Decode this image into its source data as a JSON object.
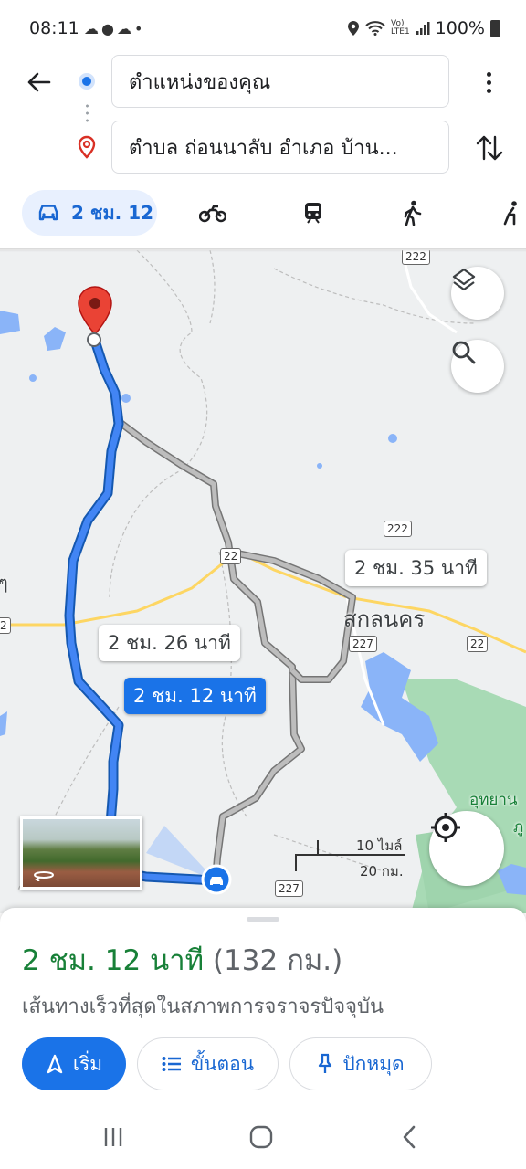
{
  "status_bar": {
    "time": "08:11",
    "battery": "100%",
    "left_icons": [
      "cloud-icon",
      "line-app-icon",
      "weather-icon",
      "dot-icon"
    ],
    "right_icons": [
      "location-icon",
      "wifi-icon",
      "volte-icon",
      "signal-icon",
      "battery-icon"
    ]
  },
  "search": {
    "origin": "ตำแหน่งของคุณ",
    "destination": "ตำบล ถ่อนนาลับ อำเภอ บ้าน..."
  },
  "travel_modes": {
    "drive_label": "2 ชม. 12",
    "modes": [
      "car-icon",
      "motorcycle-icon",
      "transit-icon",
      "walk-icon",
      "bike-icon"
    ]
  },
  "map": {
    "callouts": {
      "alt_route_1": "2 ชม. 35 นาที",
      "alt_route_2": "2 ชม. 26 นาที",
      "selected_route": "2 ชม. 12 นาที"
    },
    "place_labels": {
      "city": "สกลนคร",
      "park": "อุทยาน",
      "park_2": "ภู",
      "edge": "ๆ"
    },
    "road_badges": [
      "222",
      "222",
      "22",
      "227",
      "22",
      "2",
      "227"
    ],
    "scale": {
      "top": "10 ไมล์",
      "bottom": "20 กม."
    },
    "colors": {
      "route_selected": "#1a73e8",
      "route_alt": "#9e9e9e",
      "water": "#8ab4f8",
      "park": "#a8dab5"
    }
  },
  "sheet": {
    "duration": "2 ชม. 12 นาที",
    "distance": "(132 กม.)",
    "description": "เส้นทางเร็วที่สุดในสภาพการจราจรปัจจุบัน",
    "start_label": "เริ่ม",
    "steps_label": "ขั้นตอน",
    "pin_label": "ปักหมุด"
  },
  "nav_bar": [
    "recents-icon",
    "home-icon",
    "back-icon"
  ]
}
